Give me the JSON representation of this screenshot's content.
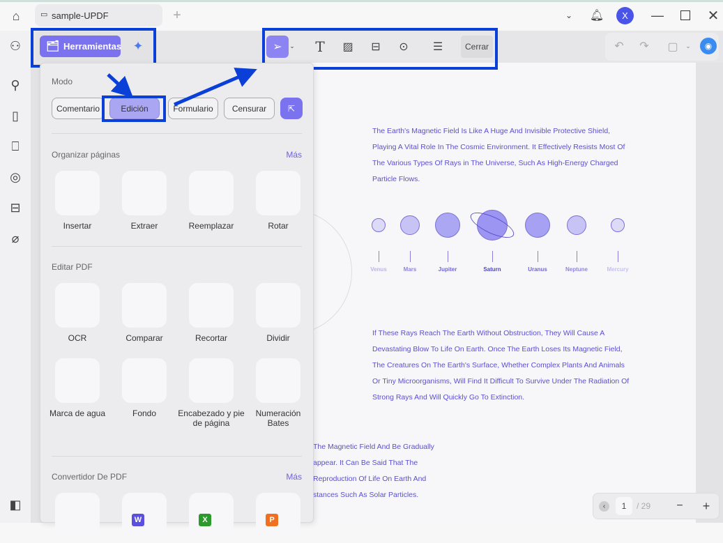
{
  "tab": {
    "title": "sample-UPDF",
    "new_tab": "+"
  },
  "window": {
    "avatar": "X",
    "icons": [
      "chevron-down-icon",
      "bell-icon",
      "minimize-icon",
      "maximize-icon",
      "close-icon"
    ]
  },
  "toolbar": {
    "tools_label": "Herramientas",
    "close_label": "Cerrar"
  },
  "panel": {
    "mode_title": "Modo",
    "modes": [
      "Comentario",
      "Edición",
      "Formulario",
      "Censurar"
    ],
    "organize_title": "Organizar páginas",
    "more": "Más",
    "organize": [
      "Insertar",
      "Extraer",
      "Reemplazar",
      "Rotar"
    ],
    "edit_title": "Editar PDF",
    "edit": [
      "OCR",
      "Comparar",
      "Recortar",
      "Dividir",
      "Marca de agua",
      "Fondo",
      "Encabezado y pie de página",
      "Numeración Bates"
    ],
    "convert_title": "Convertidor De PDF",
    "convert_icons": [
      "image-icon",
      "word-icon",
      "excel-icon",
      "powerpoint-icon"
    ],
    "convert_badges": [
      "W",
      "X",
      "P"
    ]
  },
  "document": {
    "para1": "The Earth's Magnetic Field Is Like A Huge And Invisible Protective Shield, Playing A Vital Role In The Cosmic Environment. It Effectively Resists Most Of The Various Types Of Rays in The Universe, Such As High-Energy Charged Particle Flows.",
    "planets": [
      "Venus",
      "Mars",
      "Jupiter",
      "Saturn",
      "Uranus",
      "Neptune",
      "Mercury"
    ],
    "para2": "If These Rays Reach The Earth Without Obstruction, They Will Cause A Devastating Blow To Life On Earth. Once The Earth Loses Its Magnetic Field, The Creatures On The Earth's Surface, Whether Complex Plants And Animals Or Tiny Microorganisms, Will Find It Difficult To Survive Under The Radiation Of Strong Rays And Will Quickly Go To Extinction.",
    "para3_lines": [
      "The Magnetic Field And Be Gradually",
      "appear. It Can Be Said That The",
      "Reproduction Of Life On Earth And",
      "stances Such As Solar Particles."
    ]
  },
  "pager": {
    "current": "1",
    "total": "/ 29"
  },
  "colors": {
    "accent": "#7b72f0",
    "highlight": "#0a3fd8",
    "doc_text": "#5a4fd0"
  }
}
